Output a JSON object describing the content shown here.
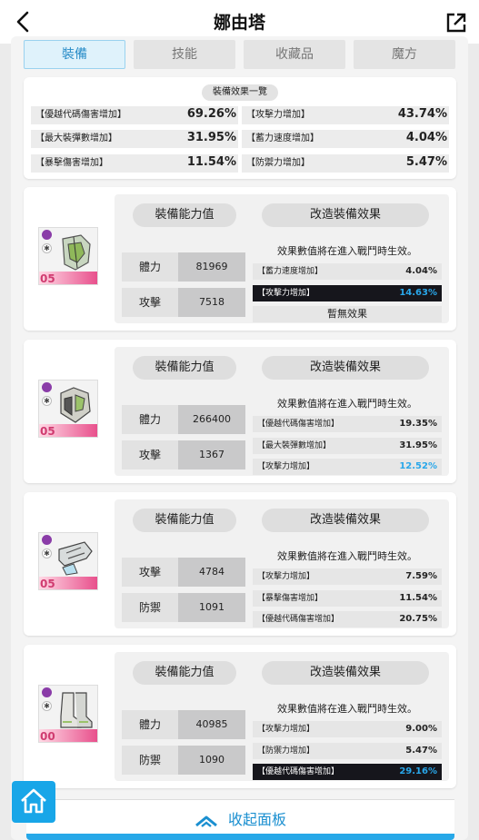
{
  "header": {
    "title": "娜由塔"
  },
  "tabs": [
    "裝備",
    "技能",
    "收藏品",
    "魔方"
  ],
  "summary": {
    "title": "裝備效果一覽",
    "rows": [
      {
        "label": "【優越代碼傷害增加】",
        "value": "69.26%"
      },
      {
        "label": "【攻擊力增加】",
        "value": "43.74%"
      },
      {
        "label": "【最大裝彈數增加】",
        "value": "31.95%"
      },
      {
        "label": "【蓄力速度增加】",
        "value": "4.04%"
      },
      {
        "label": "【暴擊傷害增加】",
        "value": "11.54%"
      },
      {
        "label": "【防禦力增加】",
        "value": "5.47%"
      }
    ]
  },
  "cards": [
    {
      "level": "05",
      "ability_label": "裝備能力值",
      "effect_label": "改造裝備效果",
      "note": "效果數值將在進入戰鬥時生效。",
      "stats": [
        {
          "label": "體力",
          "value": "81969"
        },
        {
          "label": "攻擊",
          "value": "7518"
        }
      ],
      "effects": [
        {
          "label": "【蓄力速度增加】",
          "value": "4.04%"
        },
        {
          "label": "【攻擊力增加】",
          "value": "14.63%"
        }
      ],
      "empty": "暫無效果"
    },
    {
      "level": "05",
      "ability_label": "裝備能力值",
      "effect_label": "改造裝備效果",
      "note": "效果數值將在進入戰鬥時生效。",
      "stats": [
        {
          "label": "體力",
          "value": "266400"
        },
        {
          "label": "攻擊",
          "value": "1367"
        }
      ],
      "effects": [
        {
          "label": "【優越代碼傷害增加】",
          "value": "19.35%"
        },
        {
          "label": "【最大裝彈數增加】",
          "value": "31.95%"
        },
        {
          "label": "【攻擊力增加】",
          "value": "12.52%"
        }
      ]
    },
    {
      "level": "05",
      "ability_label": "裝備能力值",
      "effect_label": "改造裝備效果",
      "note": "效果數值將在進入戰鬥時生效。",
      "stats": [
        {
          "label": "攻擊",
          "value": "4784"
        },
        {
          "label": "防禦",
          "value": "1091"
        }
      ],
      "effects": [
        {
          "label": "【攻擊力增加】",
          "value": "7.59%"
        },
        {
          "label": "【暴擊傷害增加】",
          "value": "11.54%"
        },
        {
          "label": "【優越代碼傷害增加】",
          "value": "20.75%"
        }
      ]
    },
    {
      "level": "00",
      "ability_label": "裝備能力值",
      "effect_label": "改造裝備效果",
      "note": "效果數值將在進入戰鬥時生效。",
      "stats": [
        {
          "label": "體力",
          "value": "40985"
        },
        {
          "label": "防禦",
          "value": "1090"
        }
      ],
      "effects": [
        {
          "label": "【攻擊力增加】",
          "value": "9.00%"
        },
        {
          "label": "【防禦力增加】",
          "value": "5.47%"
        },
        {
          "label": "【優越代碼傷害增加】",
          "value": "29.16%"
        }
      ]
    }
  ],
  "collapse_label": "收起面板",
  "colors": {
    "accent": "#27a8e8",
    "highlight_row": "#16161c",
    "rarity_pink": "#e8508c"
  }
}
